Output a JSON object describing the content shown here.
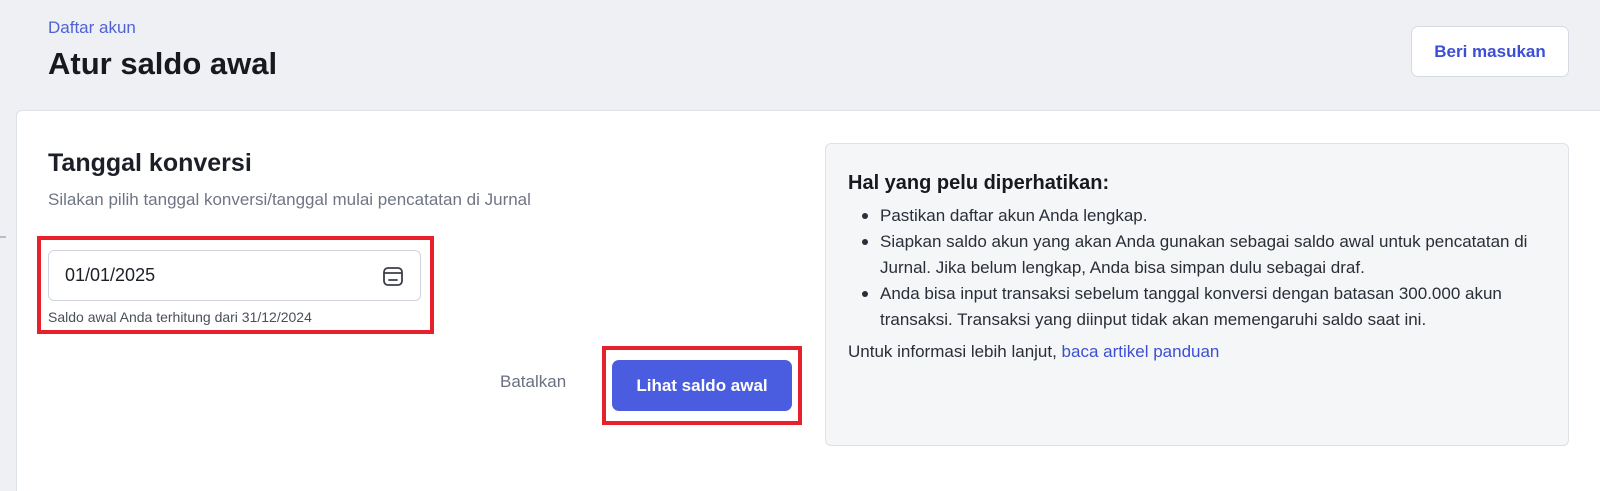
{
  "header": {
    "breadcrumb": "Daftar akun",
    "title": "Atur saldo awal",
    "feedback_button": "Beri masukan"
  },
  "conversion": {
    "title": "Tanggal konversi",
    "subtitle": "Silakan pilih tanggal konversi/tanggal mulai pencatatan di Jurnal",
    "date_value": "01/01/2025",
    "hint": "Saldo awal Anda terhitung dari 31/12/2024",
    "cancel_label": "Batalkan",
    "submit_label": "Lihat saldo awal"
  },
  "info": {
    "title": "Hal yang pelu diperhatikan:",
    "items": [
      "Pastikan daftar akun Anda lengkap.",
      "Siapkan saldo akun yang akan Anda gunakan sebagai saldo awal untuk pencatatan di Jurnal. Jika belum lengkap, Anda bisa simpan dulu sebagai draf.",
      "Anda bisa input transaksi sebelum tanggal konversi dengan batasan 300.000 akun transaksi. Transaksi yang diinput tidak akan memengaruhi saldo saat ini."
    ],
    "footer_text": "Untuk informasi lebih lanjut, ",
    "footer_link": "baca artikel panduan"
  },
  "colors": {
    "accent": "#4a5de0",
    "highlight": "#e8202b",
    "link": "#3c4fd4"
  },
  "icons": {
    "date_picker": "calendar-icon"
  }
}
